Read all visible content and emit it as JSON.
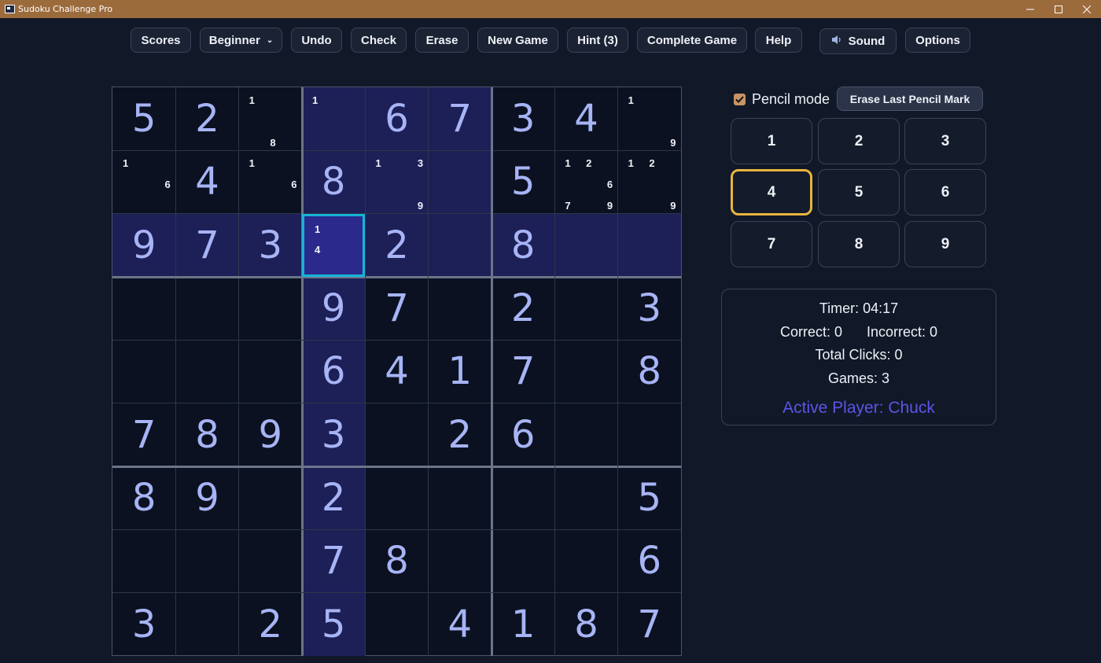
{
  "window": {
    "title": "Sudoku Challenge Pro"
  },
  "toolbar": {
    "scores": "Scores",
    "difficulty": "Beginner",
    "undo": "Undo",
    "check": "Check",
    "erase": "Erase",
    "new_game": "New Game",
    "hint": "Hint (3)",
    "complete_game": "Complete Game",
    "help": "Help",
    "sound": "Sound",
    "options": "Options"
  },
  "board": {
    "values": [
      [
        5,
        2,
        0,
        0,
        6,
        7,
        3,
        4,
        0
      ],
      [
        0,
        4,
        0,
        8,
        0,
        0,
        5,
        0,
        0
      ],
      [
        9,
        7,
        3,
        0,
        2,
        0,
        8,
        0,
        0
      ],
      [
        0,
        0,
        0,
        9,
        7,
        0,
        2,
        0,
        3
      ],
      [
        0,
        0,
        0,
        6,
        4,
        1,
        7,
        0,
        8
      ],
      [
        7,
        8,
        9,
        3,
        0,
        2,
        6,
        0,
        0
      ],
      [
        8,
        9,
        0,
        2,
        0,
        0,
        0,
        0,
        5
      ],
      [
        0,
        0,
        0,
        7,
        8,
        0,
        0,
        0,
        6
      ],
      [
        3,
        0,
        2,
        5,
        0,
        4,
        1,
        8,
        7
      ]
    ],
    "pencil_marks": [
      {
        "row": 0,
        "col": 2,
        "marks": [
          "1",
          "8"
        ]
      },
      {
        "row": 0,
        "col": 3,
        "marks": [
          "1"
        ]
      },
      {
        "row": 0,
        "col": 8,
        "marks": [
          "1",
          "9"
        ]
      },
      {
        "row": 1,
        "col": 0,
        "marks": [
          "1",
          "6"
        ]
      },
      {
        "row": 1,
        "col": 2,
        "marks": [
          "1",
          "6"
        ]
      },
      {
        "row": 1,
        "col": 4,
        "marks": [
          "1",
          "3",
          "9"
        ]
      },
      {
        "row": 1,
        "col": 7,
        "marks": [
          "1",
          "2",
          "6",
          "7",
          "9"
        ]
      },
      {
        "row": 1,
        "col": 8,
        "marks": [
          "1",
          "2",
          "9"
        ]
      },
      {
        "row": 2,
        "col": 3,
        "marks": [
          "1",
          "4"
        ]
      }
    ],
    "selected": {
      "row": 2,
      "col": 3
    }
  },
  "panel": {
    "pencil_mode_label": "Pencil mode",
    "pencil_mode_checked": true,
    "erase_pencil_label": "Erase Last Pencil Mark",
    "numpad": [
      "1",
      "2",
      "3",
      "4",
      "5",
      "6",
      "7",
      "8",
      "9"
    ],
    "numpad_active": "4",
    "timer": "Timer: 04:17",
    "correct": "Correct: 0",
    "incorrect": "Incorrect: 0",
    "total_clicks": "Total Clicks: 0",
    "games": "Games: 3",
    "active_player": "Active Player: Chuck"
  },
  "colors": {
    "accent_player": "#5b55e8",
    "selection_border": "#16b4d6",
    "numpad_active_border": "#e8b43e",
    "titlebar": "#9c6b3c"
  }
}
